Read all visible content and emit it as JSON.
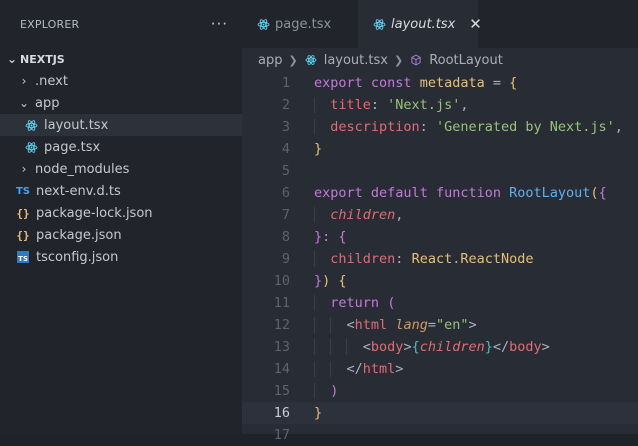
{
  "sidebar": {
    "title": "EXPLORER",
    "more_label": "···",
    "root": "NEXTJS",
    "items": [
      {
        "label": ".next",
        "chevron": "›",
        "type": "folder"
      },
      {
        "label": "app",
        "chevron": "⌄",
        "type": "folder"
      },
      {
        "label": "layout.tsx",
        "type": "react",
        "selected": true
      },
      {
        "label": "page.tsx",
        "type": "react"
      },
      {
        "label": "node_modules",
        "chevron": "›",
        "type": "folder"
      },
      {
        "label": "next-env.d.ts",
        "type": "ts",
        "icon_text": "TS"
      },
      {
        "label": "package-lock.json",
        "type": "json",
        "icon_text": "{}"
      },
      {
        "label": "package.json",
        "type": "json",
        "icon_text": "{}"
      },
      {
        "label": "tsconfig.json",
        "type": "tsconfig",
        "icon_text": "TS"
      }
    ]
  },
  "tabs": [
    {
      "label": "page.tsx",
      "active": false
    },
    {
      "label": "layout.tsx",
      "active": true,
      "close": "✕"
    }
  ],
  "breadcrumb": {
    "folder": "app",
    "file": "layout.tsx",
    "symbol": "RootLayout"
  },
  "editor": {
    "current_line": 16,
    "line_numbers": [
      "1",
      "2",
      "3",
      "4",
      "5",
      "6",
      "7",
      "8",
      "9",
      "10",
      "11",
      "12",
      "13",
      "14",
      "15",
      "16",
      "17"
    ],
    "tokens": {
      "export": "export",
      "const": "const",
      "metadata": "metadata",
      "eq": " = ",
      "open_brace": "{",
      "close_brace": "}",
      "title_key": "title",
      "colon": ": ",
      "title_val": "'Next.js'",
      "comma": ",",
      "desc_key": "description",
      "desc_val": "'Generated by Next.js'",
      "default": "default",
      "function": "function",
      "fn_name": "RootLayout",
      "paren_open": "(",
      "paren_close": ")",
      "children": "children",
      "colon_brace": "}: {",
      "react": "React",
      "dot": ".",
      "react_node": "ReactNode",
      "return": "return",
      "lt": "<",
      "gt": ">",
      "lt_slash": "</",
      "html": "html",
      "lang": "lang",
      "eq_plain": "=",
      "lang_val": "\"en\"",
      "body": "body"
    }
  }
}
